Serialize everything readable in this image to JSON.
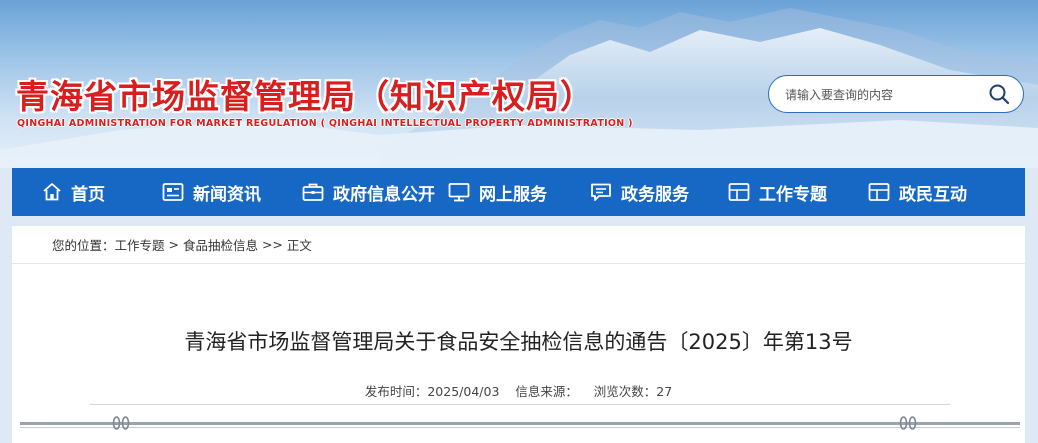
{
  "header": {
    "title": "青海省市场监督管理局（知识产权局）",
    "subtitle": "QINGHAI ADMINISTRATION FOR MARKET REGULATION ( QINGHAI INTELLECTUAL PROPERTY ADMINISTRATION )",
    "search": {
      "placeholder": "请输入要查询的内容",
      "icon": "search-icon"
    }
  },
  "nav": {
    "items": [
      {
        "label": "首页",
        "icon": "home-icon"
      },
      {
        "label": "新闻资讯",
        "icon": "news-icon"
      },
      {
        "label": "政府信息公开",
        "icon": "briefcase-icon"
      },
      {
        "label": "网上服务",
        "icon": "monitor-icon"
      },
      {
        "label": "政务服务",
        "icon": "chat-icon"
      },
      {
        "label": "工作专题",
        "icon": "window-icon"
      },
      {
        "label": "政民互动",
        "icon": "window-icon"
      }
    ]
  },
  "breadcrumb": {
    "prefix": "您的位置：",
    "items": [
      "工作专题",
      "食品抽检信息",
      "正文"
    ],
    "separators": [
      " > ",
      " >> "
    ]
  },
  "article": {
    "title": "青海省市场监督管理局关于食品安全抽检信息的通告〔2025〕年第13号",
    "meta": {
      "publish_label": "发布时间：",
      "publish_date": "2025/04/03",
      "source_label": "信息来源：",
      "source_value": "",
      "views_label": "浏览次数：",
      "views_value": "27"
    }
  },
  "colors": {
    "title_red": "#d81e1e",
    "nav_blue": "#1767c5",
    "search_border": "#2a6ec2"
  }
}
